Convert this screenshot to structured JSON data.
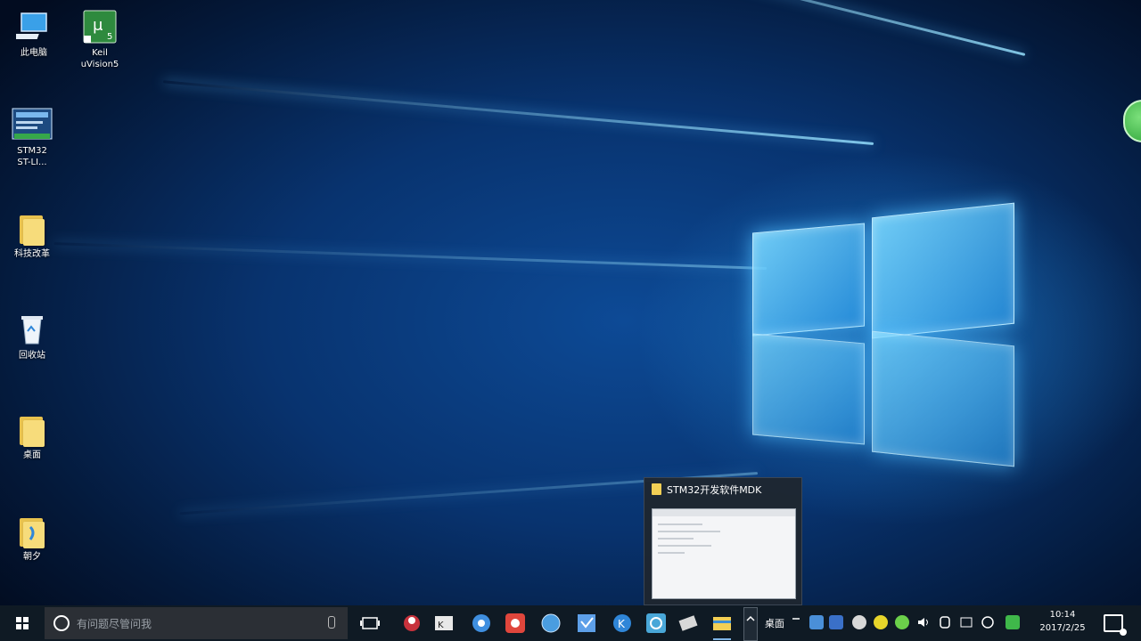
{
  "desktop": {
    "icons": [
      {
        "label": "此电脑",
        "icon": "computer-icon"
      },
      {
        "label": "Keil uVision5",
        "icon": "keil-icon"
      },
      {
        "label": "STM32 ST-LI...",
        "icon": "stlink-icon"
      },
      {
        "label": "科技改革",
        "icon": "folder-icon"
      },
      {
        "label": "回收站",
        "icon": "recycle-bin-icon"
      },
      {
        "label": "桌面",
        "icon": "folder-icon"
      },
      {
        "label": "朝夕",
        "icon": "folder-icon"
      }
    ]
  },
  "preview": {
    "title": "STM32开发软件MDK"
  },
  "taskbar": {
    "search_placeholder": "有问题尽管问我",
    "desktop_label": "桌面",
    "clock_time": "10:14",
    "clock_date": "2017/2/25",
    "apps": [
      {
        "icon": "red-bird-app-icon",
        "color": "#c8323c"
      },
      {
        "icon": "kmplayer-app-icon",
        "color": "#e8e8e8"
      },
      {
        "icon": "baidu-app-icon",
        "color": "#3f8fe0"
      },
      {
        "icon": "red-app-icon",
        "color": "#e0463c"
      },
      {
        "icon": "globe-app-icon",
        "color": "#4a9de0"
      },
      {
        "icon": "shield-app-icon",
        "color": "#5d9fe8"
      },
      {
        "icon": "k-app-icon",
        "color": "#2f86d8"
      },
      {
        "icon": "image-app-icon",
        "color": "#49a7d8"
      },
      {
        "icon": "tool-app-icon",
        "color": "#d8d8d8"
      },
      {
        "icon": "file-explorer-icon",
        "color": "#f2cf55"
      }
    ]
  }
}
